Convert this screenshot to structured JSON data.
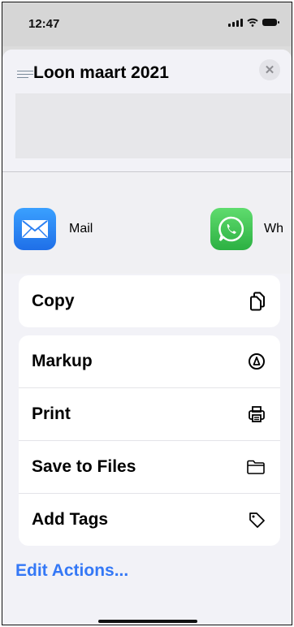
{
  "status_bar": {
    "time": "12:47"
  },
  "header": {
    "title": "Loon maart 2021",
    "close_symbol": "✕"
  },
  "apps": [
    {
      "label": "Mail",
      "icon": "mail-icon",
      "color": "#1f6fe8"
    },
    {
      "label": "Wh",
      "icon": "whatsapp-icon",
      "color": "#2cb042"
    }
  ],
  "actions": {
    "copy": {
      "label": "Copy",
      "icon": "copy-icon"
    },
    "markup": {
      "label": "Markup",
      "icon": "markup-icon"
    },
    "print": {
      "label": "Print",
      "icon": "print-icon"
    },
    "save_to_files": {
      "label": "Save to Files",
      "icon": "folder-icon"
    },
    "add_tags": {
      "label": "Add Tags",
      "icon": "tag-icon"
    }
  },
  "edit_actions": {
    "label": "Edit Actions..."
  },
  "colors": {
    "accent": "#3478f6",
    "sheet_bg": "#f2f2f7"
  }
}
